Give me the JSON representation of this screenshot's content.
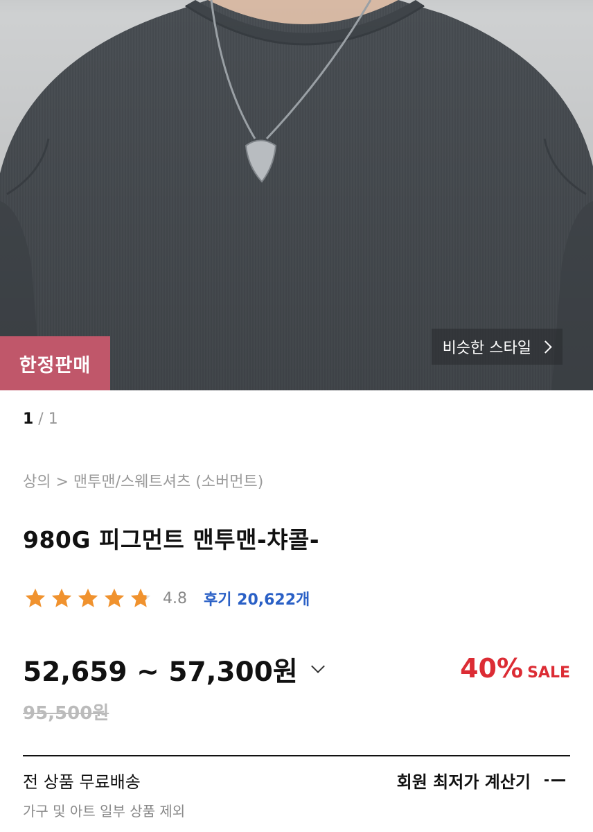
{
  "hero": {
    "badge": "한정판매",
    "similar_style": "비슷한 스타일"
  },
  "pager": {
    "current": "1",
    "separator": " / ",
    "total": "1"
  },
  "breadcrumb": "상의 > 맨투맨/스웨트셔츠 (소버먼트)",
  "product": {
    "title": "980G 피그먼트 맨투맨-챠콜-",
    "rating": "4.8",
    "stars": 4.8,
    "reviews": "후기 20,622개",
    "price": "52,659 ~ 57,300원",
    "discount_pct": "40%",
    "discount_label": "SALE",
    "original_price": "95,500원"
  },
  "shipping": {
    "title": "전 상품 무료배송",
    "note": "가구 및 아트 일부 상품 제외",
    "calc_label": "회원 최저가 계산기"
  },
  "colors": {
    "badge": "#c0576a",
    "star": "#f0922e",
    "review_link": "#2a60c6",
    "discount": "#dc2c34"
  }
}
